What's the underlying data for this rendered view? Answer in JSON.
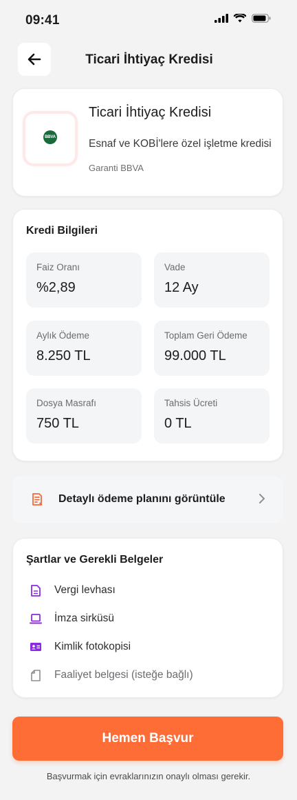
{
  "status_bar": {
    "time": "09:41"
  },
  "header": {
    "title": "Ticari İhtiyaç Kredisi"
  },
  "product": {
    "logo_text": "BBVA",
    "name": "Ticari İhtiyaç Kredisi",
    "description": "Esnaf ve KOBİ'lere özel işletme kredisi",
    "bank": "Garanti BBVA"
  },
  "credit_info": {
    "heading": "Kredi Bilgileri",
    "tiles": [
      {
        "label": "Faiz Oranı",
        "value": "%2,89"
      },
      {
        "label": "Vade",
        "value": "12 Ay"
      },
      {
        "label": "Aylık Ödeme",
        "value": "8.250 TL"
      },
      {
        "label": "Toplam Geri Ödeme",
        "value": "99.000 TL"
      },
      {
        "label": "Dosya Masrafı",
        "value": "750 TL"
      },
      {
        "label": "Tahsis Ücreti",
        "value": "0 TL"
      }
    ]
  },
  "payment_plan": {
    "label": "Detaylı ödeme planını görüntüle"
  },
  "documents": {
    "heading": "Şartlar ve Gerekli Belgeler",
    "items": [
      {
        "label": "Vergi levhası",
        "icon": "document-icon"
      },
      {
        "label": "İmza sirküsü",
        "icon": "laptop-icon"
      },
      {
        "label": "Kimlik fotokopisi",
        "icon": "id-card-icon"
      },
      {
        "label": "Faaliyet belgesi (isteğe bağlı)",
        "icon": "file-outline-icon"
      }
    ]
  },
  "cta": {
    "label": "Hemen Başvur"
  },
  "footer_note": "Başvurmak için evraklarınızın onaylı olması gerekir.",
  "colors": {
    "accent": "#fe6d35",
    "icon_purple": "#8a2be2",
    "plan_icon": "#f26a3a",
    "logo_green": "#1a6b3b"
  }
}
